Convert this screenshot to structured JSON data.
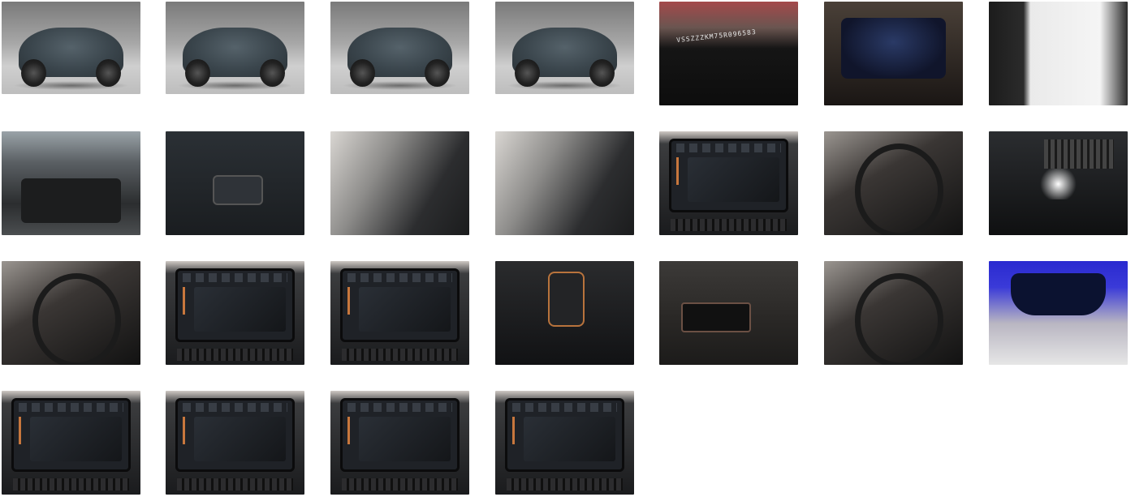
{
  "gallery": {
    "columns": 7,
    "rows": 4,
    "items": [
      {
        "id": 1,
        "kind": "studio",
        "icon": "car-front-left-photo"
      },
      {
        "id": 2,
        "kind": "studio",
        "icon": "car-rear-left-photo"
      },
      {
        "id": 3,
        "kind": "studio",
        "icon": "car-rear-right-photo"
      },
      {
        "id": 4,
        "kind": "studio",
        "icon": "car-front-right-photo"
      },
      {
        "id": 5,
        "kind": "vin",
        "icon": "vin-plate-photo",
        "text": "VSSZZZKM75R096583"
      },
      {
        "id": 6,
        "kind": "cluster",
        "icon": "instrument-cluster-photo"
      },
      {
        "id": 7,
        "kind": "doc",
        "icon": "documents-keys-photo"
      },
      {
        "id": 8,
        "kind": "trunk",
        "icon": "trunk-photo"
      },
      {
        "id": 9,
        "kind": "panel",
        "icon": "tailgate-button-photo"
      },
      {
        "id": 10,
        "kind": "interior",
        "icon": "rear-seats-photo"
      },
      {
        "id": 11,
        "kind": "interior",
        "icon": "dashboard-photo"
      },
      {
        "id": 12,
        "kind": "screen",
        "icon": "parking-camera-photo"
      },
      {
        "id": 13,
        "kind": "wheel",
        "icon": "steering-wheel-photo"
      },
      {
        "id": 14,
        "kind": "vent",
        "icon": "rear-vent-photo"
      },
      {
        "id": 15,
        "kind": "wheel",
        "icon": "wheel-controls-photo"
      },
      {
        "id": 16,
        "kind": "screen",
        "icon": "infotainment-apps-photo"
      },
      {
        "id": 17,
        "kind": "screen",
        "icon": "infotainment-climate-photo"
      },
      {
        "id": 18,
        "kind": "shifter",
        "icon": "gear-selector-photo"
      },
      {
        "id": 19,
        "kind": "door",
        "icon": "window-switches-photo"
      },
      {
        "id": 20,
        "kind": "wheel",
        "icon": "drive-mode-button-photo"
      },
      {
        "id": 21,
        "kind": "mirror",
        "icon": "rearview-mirror-photo"
      },
      {
        "id": 22,
        "kind": "screen",
        "icon": "infotainment-service-photo"
      },
      {
        "id": 23,
        "kind": "screen",
        "icon": "infotainment-ambient-photo"
      },
      {
        "id": 24,
        "kind": "screen",
        "icon": "infotainment-seat-photo"
      },
      {
        "id": 25,
        "kind": "screen",
        "icon": "infotainment-settings-photo"
      }
    ]
  },
  "colors": {
    "background": "#ffffff",
    "car_paint": "#3a454c",
    "accent_copper": "#c8773d"
  }
}
